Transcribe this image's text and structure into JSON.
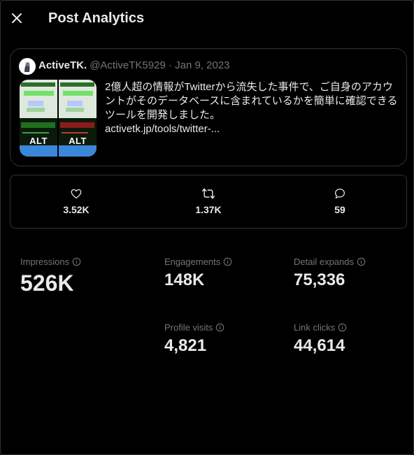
{
  "header": {
    "title": "Post Analytics",
    "close_icon": "close-icon"
  },
  "tweet": {
    "author_name": "ActiveTK.",
    "author_meta": "@ActiveTK5929 · Jan 9, 2023",
    "text": "2億人超の情報がTwitterから流失した事件で、ご自身のアカウントがそのデータベースに含まれているかを簡単に確認できるツールを開発しました。",
    "link": "activetk.jp/tools/twitter-...",
    "media": [
      {
        "alt": "ALT"
      },
      {
        "alt": "ALT"
      }
    ]
  },
  "engagement": {
    "likes": "3.52K",
    "reposts": "1.37K",
    "replies": "59",
    "likes_icon": "heart-icon",
    "reposts_icon": "repost-icon",
    "replies_icon": "reply-icon"
  },
  "metrics": {
    "impressions": {
      "label": "Impressions",
      "value": "526K"
    },
    "engagements": {
      "label": "Engagements",
      "value": "148K"
    },
    "detail_expands": {
      "label": "Detail expands",
      "value": "75,336"
    },
    "profile_visits": {
      "label": "Profile visits",
      "value": "4,821"
    },
    "link_clicks": {
      "label": "Link clicks",
      "value": "44,614"
    }
  },
  "colors": {
    "background": "#000000",
    "text_primary": "#e7e9ea",
    "text_secondary": "#71767b",
    "border": "#2f3336"
  }
}
